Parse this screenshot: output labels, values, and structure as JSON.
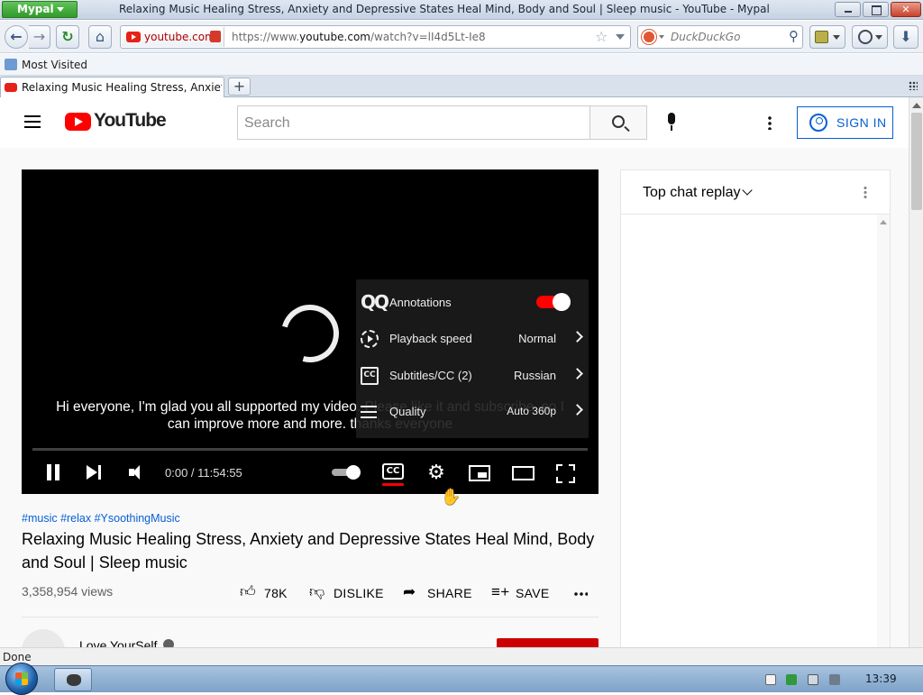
{
  "browser": {
    "app_button": "Mypal",
    "window_title": "Relaxing Music Healing Stress, Anxiety and Depressive States Heal Mind, Body and Soul | Sleep music - YouTube - Mypal",
    "site_domain": "youtube.com",
    "url_prefix": "https://www.",
    "url_host": "youtube.com",
    "url_path": "/watch?v=lI4d5Lt-Ie8",
    "search_engine_placeholder": "DuckDuckGo",
    "bookmark": "Most Visited",
    "tab_title": "Relaxing Music Healing Stress, Anxiety a...",
    "new_tab": "+",
    "status": "Done"
  },
  "youtube": {
    "logo_text": "YouTube",
    "search_placeholder": "Search",
    "signin_label": "SIGN IN",
    "player": {
      "caption_line1": "Hi everyone, I'm glad you all supported my video. Please like it and subscribe, so I",
      "caption_line2": "can improve more and more. thanks everyone",
      "time": "0:00 / 11:54:55",
      "cc_label": "CC",
      "settings_menu": [
        {
          "label": "Annotations",
          "value": "",
          "icon": "annotations-icon",
          "toggle_on": true
        },
        {
          "label": "Playback speed",
          "value": "Normal",
          "icon": "playback-speed-icon"
        },
        {
          "label": "Subtitles/CC (2)",
          "value": "Russian",
          "icon": "subtitles-icon"
        },
        {
          "label": "Quality",
          "value": "Auto 360p",
          "icon": "quality-icon"
        }
      ],
      "subtitles_icon_text": "CC",
      "annotations_icon_text": "QQ"
    },
    "hashtags": "#music #relax #YsoothingMusic",
    "video_title": "Relaxing Music Healing Stress, Anxiety and Depressive States Heal Mind, Body and Soul | Sleep music",
    "views": "3,358,954 views",
    "actions": {
      "like": "78K",
      "dislike": "DISLIKE",
      "share": "SHARE",
      "save": "SAVE"
    },
    "channel_name": "Love YourSelf",
    "chat": {
      "title": "Top chat replay"
    }
  },
  "taskbar": {
    "clock": "13:39"
  },
  "colors": {
    "youtube_red": "#ff0000",
    "link_blue": "#065fd4",
    "toggle_red": "#ff0000"
  }
}
